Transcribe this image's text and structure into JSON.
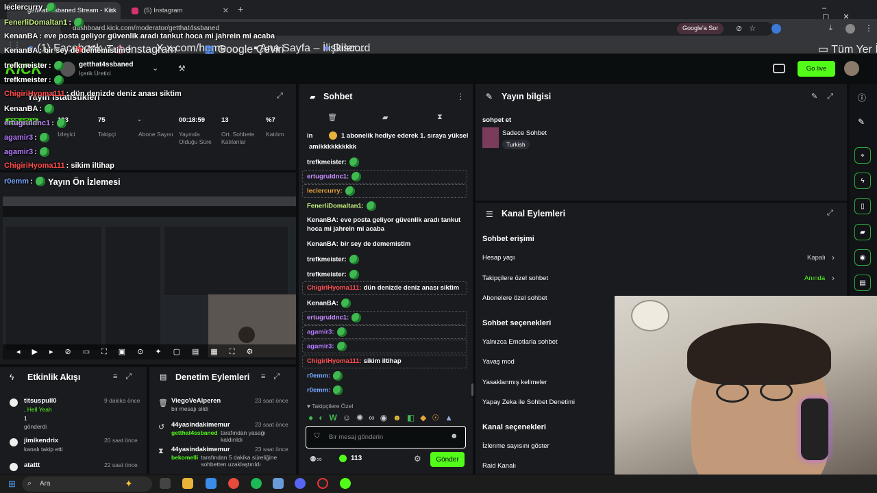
{
  "browser": {
    "tabs": [
      {
        "label": "getthat4ssbaned Stream - Kick"
      },
      {
        "label": "(5) Instagram"
      }
    ],
    "url": "dashboard.kick.com/moderator/getthat4ssbaned",
    "google_ask": "Google'a Sor",
    "bookmarks": [
      "(1) Facebook",
      "YouTube",
      "Instagram",
      "x.com/home",
      "Google Çeviri",
      "Ana Sayfa – İlişkiler...",
      "Discord"
    ],
    "all_bookmarks": "Tüm Yer İşaretleri"
  },
  "kick": {
    "logo": "KICK",
    "channel": "getthat4ssbaned",
    "role": "İçerik Üretici",
    "go_live": "Go live"
  },
  "overlay": {
    "lines": [
      {
        "user": "leclercurry",
        "msg": ""
      },
      {
        "user": "FenerliDomaltan1",
        "msg": ":"
      },
      {
        "user": "KenanBA",
        "msg": ": eve posta geliyor güvenlik aradı tankut hoca mi jahrein mi acaba"
      },
      {
        "user": "KenanBA",
        "msg": ": bir sey de dememistim"
      },
      {
        "user": "trefkmeister",
        "msg": ":"
      },
      {
        "user": "trefkmeister",
        "msg": ":"
      },
      {
        "user": "ChigiriHyoma111",
        "msg": ": dün denizde deniz anası siktim"
      },
      {
        "user": "KenanBA",
        "msg": ":"
      },
      {
        "user": "ertugruldnc1",
        "msg": ":"
      },
      {
        "user": "agamir3",
        "msg": ":"
      },
      {
        "user": "agamir3",
        "msg": ":"
      },
      {
        "user": "ChigiriHyoma111",
        "msg": ": sikim iltihap"
      },
      {
        "user": "r0emm",
        "msg": ":"
      }
    ]
  },
  "stats": {
    "title": "Yayın İstatistikleri",
    "live_badge": "POPUNDLM",
    "items": [
      {
        "value": "193",
        "label": "İzleyici"
      },
      {
        "value": "75",
        "label": "Takipçi"
      },
      {
        "value": "-",
        "label": "Abone Sayısı"
      },
      {
        "value": "00:18:59",
        "label": "Yayında Olduğu Süre"
      },
      {
        "value": "13",
        "label": "Ort. Sohbete Katılanlar"
      },
      {
        "value": "%7",
        "label": "Katılım"
      }
    ]
  },
  "preview": {
    "title": "Yayın Ön İzlemesi"
  },
  "activity": {
    "title": "Etkinlik Akışı",
    "items": [
      {
        "user": "titsuspull0",
        "time": "9 dakika önce",
        "sub": ", Hell Yeah",
        "sub2": "1",
        "sub3": "gönderdi"
      },
      {
        "user": "jimikendrix",
        "time": "20 saat önce",
        "sub": "kanalı takip etti"
      },
      {
        "user": "atattt",
        "time": "22 saat önce",
        "sub": ""
      }
    ]
  },
  "modlog": {
    "title": "Denetim Eylemleri",
    "items": [
      {
        "user": "ViegoVeAlperen",
        "time": "23 saat önce",
        "desc": "bir mesajı sildi",
        "actor": ""
      },
      {
        "user": "44yasindakimemur",
        "time": "23 saat önce",
        "actor": "getthat4ssbaned",
        "desc": " tarafından yasağı kaldırıldı"
      },
      {
        "user": "44yasindakimemur",
        "time": "23 saat önce",
        "actor": "bekomelli",
        "desc": " tarafından 5 dakika süreliğine sohbetten uzaklaştırıldı"
      }
    ]
  },
  "chat": {
    "title": "Sohbet",
    "pinned_prefix": "in",
    "pinned": "1 abonelik hediye ederek 1. sıraya yüksel",
    "messages": [
      {
        "user": "",
        "text": "amikkkkkkkkkk",
        "color": "#ffffff",
        "outlined": false
      },
      {
        "user": "trefkmeister:",
        "text": "",
        "color": "#ffffff",
        "outlined": false
      },
      {
        "user": "ertugruldnc1:",
        "text": "",
        "color": "#c78bff",
        "outlined": true
      },
      {
        "user": "leclercurry:",
        "text": "",
        "color": "#e8a33b",
        "outlined": true
      },
      {
        "user": "FenerliDomaltan1:",
        "text": "",
        "color": "#c7f27f",
        "outlined": false
      },
      {
        "user": "KenanBA:",
        "text": "eve posta geliyor güvenlik aradı tankut hoca mi jahrein mi acaba",
        "color": "#ffffff",
        "outlined": false
      },
      {
        "user": "KenanBA:",
        "text": "bir sey de dememistim",
        "color": "#ffffff",
        "outlined": false
      },
      {
        "user": "trefkmeister:",
        "text": "",
        "color": "#ffffff",
        "outlined": false
      },
      {
        "user": "trefkmeister:",
        "text": "",
        "color": "#ffffff",
        "outlined": false
      },
      {
        "user": "ChigiriHyoma111:",
        "text": "dün denizde deniz anası siktim",
        "color": "#ff4d4d",
        "outlined": true
      },
      {
        "user": "KenanBA:",
        "text": "",
        "color": "#ffffff",
        "outlined": false
      },
      {
        "user": "ertugruldnc1:",
        "text": "",
        "color": "#c78bff",
        "outlined": true
      },
      {
        "user": "agamir3:",
        "text": "",
        "color": "#b57bff",
        "outlined": true
      },
      {
        "user": "agamir3:",
        "text": "",
        "color": "#b57bff",
        "outlined": true
      },
      {
        "user": "ChigiriHyoma111:",
        "text": "sikim iltihap",
        "color": "#ff4d4d",
        "outlined": true
      },
      {
        "user": "r0emm:",
        "text": "",
        "color": "#7aa8ff",
        "outlined": false
      },
      {
        "user": "r0emm:",
        "text": "",
        "color": "#7aa8ff",
        "outlined": false
      }
    ],
    "followers_only": "Takipçilere Özel",
    "placeholder": "Bir mesaj gönderin",
    "points": "113",
    "send": "Gönder"
  },
  "info": {
    "title": "Yayın bilgisi",
    "stream_title": "sohpet et",
    "category": "Sadece Sohbet",
    "language": "Turkish"
  },
  "actions": {
    "title": "Kanal Eylemleri",
    "sections": [
      {
        "heading": "Sohbet erişimi",
        "rows": [
          {
            "label": "Hesap yaşı",
            "value": "Kapalı"
          },
          {
            "label": "Takipçilere özel sohbet",
            "value": "Anında"
          },
          {
            "label": "Abonelere özel sohbet",
            "value": ""
          }
        ]
      },
      {
        "heading": "Sohbet seçenekleri",
        "rows": [
          {
            "label": "Yalnızca Emotlarla sohbet",
            "value": ""
          },
          {
            "label": "Yavaş mod",
            "value": ""
          },
          {
            "label": "Yasaklanmış kelimeler",
            "value": ""
          },
          {
            "label": "Yapay Zeka ile Sohbet Denetimi",
            "value": ""
          }
        ]
      },
      {
        "heading": "Kanal seçenekleri",
        "rows": [
          {
            "label": "İzlenme sayısını göster",
            "value": ""
          },
          {
            "label": "Raid Kanalı",
            "value": ""
          }
        ]
      }
    ]
  },
  "taskbar": {
    "search": "Ara"
  },
  "colors": {
    "brand": "#53fc18",
    "panel": "#191b1f",
    "bg": "#0b0e0f"
  }
}
